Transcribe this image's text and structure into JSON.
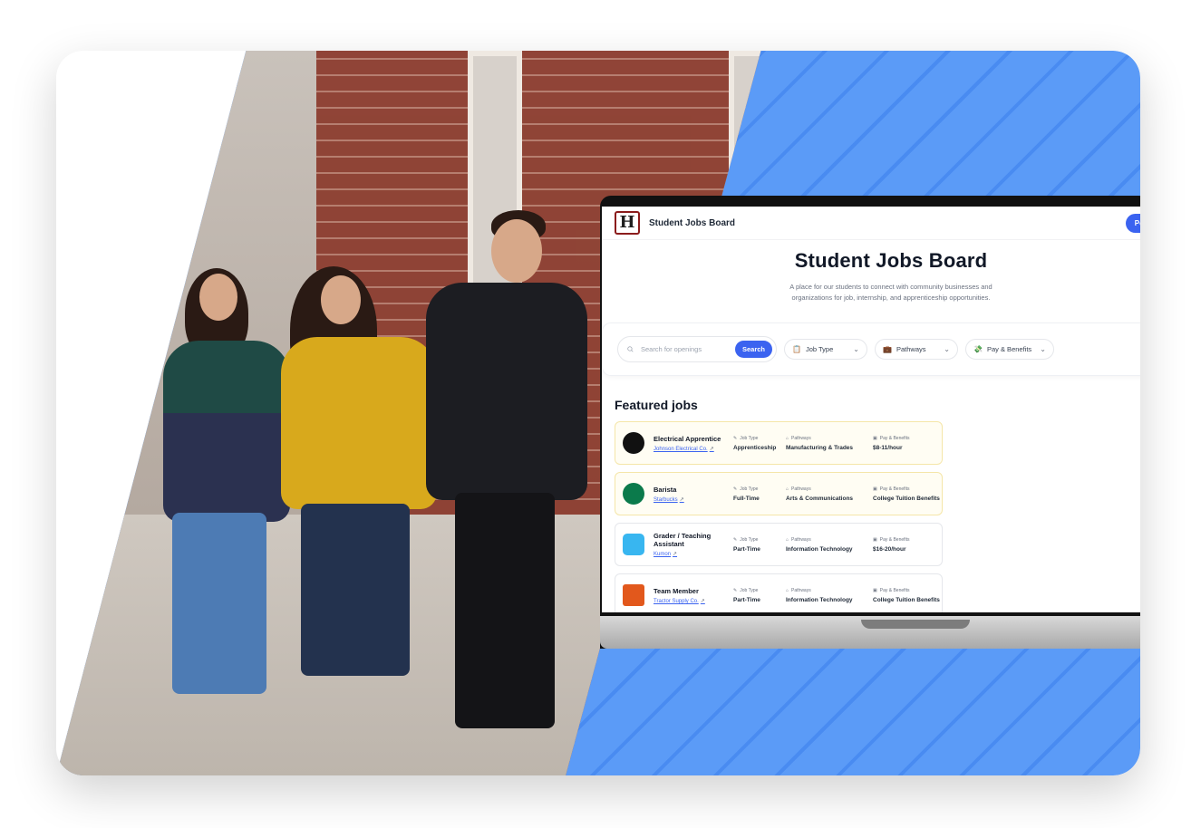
{
  "site": {
    "name": "Student Jobs Board",
    "logo_letter": "H"
  },
  "header": {
    "post_button": "Post a job"
  },
  "hero": {
    "title": "Student Jobs Board",
    "subtitle": "A place for our students to connect with community businesses and organizations for job, internship, and apprenticeship opportunities."
  },
  "filters": {
    "search_placeholder": "Search for openings",
    "search_button": "Search",
    "job_type": "Job Type",
    "pathways": "Pathways",
    "pay": "Pay & Benefits"
  },
  "featured": {
    "title": "Featured jobs",
    "labels": {
      "job_type": "Job Type",
      "pathways": "Pathways",
      "pay": "Pay & Benefits"
    },
    "jobs": [
      {
        "title": "Electrical Apprentice",
        "company": "Johnson Electrical Co.",
        "job_type": "Apprenticeship",
        "pathway": "Manufacturing & Trades",
        "pay": "$8-11/hour",
        "logo_color": "#111111",
        "featured": true
      },
      {
        "title": "Barista",
        "company": "Starbucks",
        "job_type": "Full-Time",
        "pathway": "Arts & Communications",
        "pay": "College Tuition Benefits",
        "logo_color": "#0b7a4b",
        "featured": true
      },
      {
        "title": "Grader / Teaching Assistant",
        "company": "Kumon",
        "job_type": "Part-Time",
        "pathway": "Information Technology",
        "pay": "$16-20/hour",
        "logo_color": "#38b6f0",
        "featured": false
      },
      {
        "title": "Team Member",
        "company": "Tractor Supply Co.",
        "job_type": "Part-Time",
        "pathway": "Information Technology",
        "pay": "College Tuition Benefits",
        "logo_color": "#e2581c",
        "featured": false
      }
    ]
  }
}
